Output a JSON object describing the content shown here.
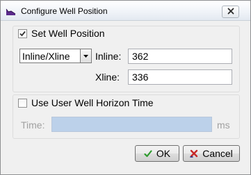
{
  "window": {
    "title": "Configure Well Position"
  },
  "set_well_position": {
    "label": "Set Well Position",
    "checked": true,
    "mode_selected": "Inline/Xline",
    "inline_label": "Inline:",
    "inline_value": "362",
    "xline_label": "Xline:",
    "xline_value": "336"
  },
  "horizon_time": {
    "label": "Use User Well Horizon Time",
    "checked": false,
    "time_label": "Time:",
    "time_value": "",
    "unit": "ms"
  },
  "buttons": {
    "ok_label": "OK",
    "cancel_label": "Cancel"
  },
  "icons": {
    "app": "purple-horizon-icon",
    "close": "close-icon",
    "ok": "green-check-icon",
    "cancel": "red-x-icon"
  },
  "colors": {
    "ok_icon": "#2e9b2e",
    "cancel_icon": "#c62828",
    "app_icon": "#5b2a8c",
    "disabled_field": "#bcd1ea"
  }
}
